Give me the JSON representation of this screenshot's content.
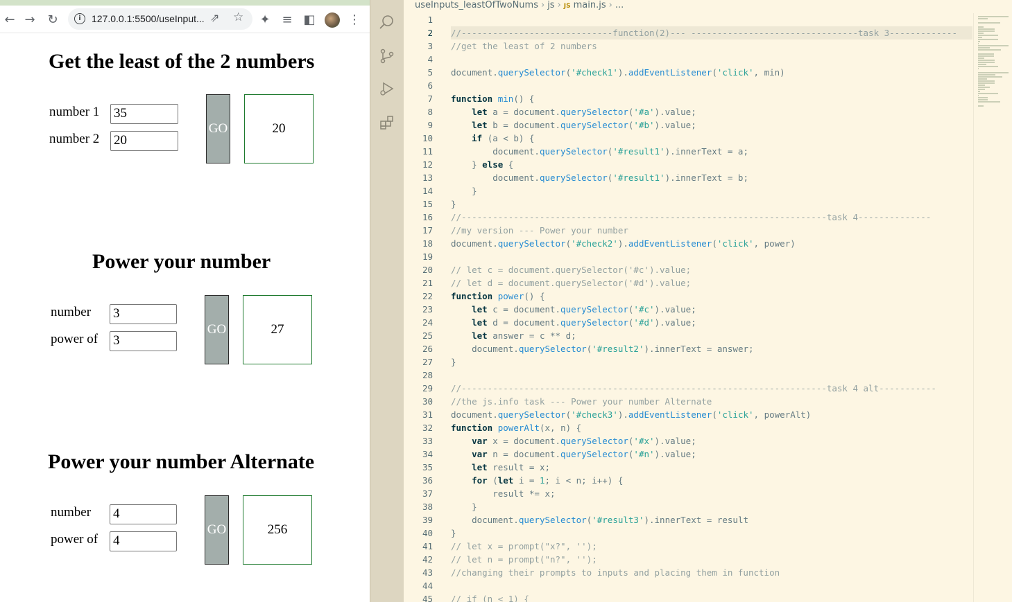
{
  "browser": {
    "url": "127.0.0.1:5500/useInput...",
    "sections": [
      {
        "title": "Get the least of the 2 numbers",
        "label1": "number 1",
        "label2": "number 2",
        "value1": "35",
        "value2": "20",
        "go_label": "GO",
        "result": "20"
      },
      {
        "title": "Power your number",
        "label1": "number",
        "label2": "power of",
        "value1": "3",
        "value2": "3",
        "go_label": "GO",
        "result": "27"
      },
      {
        "title": "Power your number Alternate",
        "label1": "number",
        "label2": "power of",
        "value1": "4",
        "value2": "4",
        "go_label": "GO",
        "result": "256"
      }
    ]
  },
  "editor": {
    "breadcrumb": {
      "folder": "useInputs_leastOfTwoNums",
      "subfolder": "js",
      "file_badge": "JS",
      "file": "main.js",
      "more": "..."
    },
    "active_line": 2,
    "lines": [
      [],
      [
        [
          "cm",
          "//-----------------------------function(2)--- --------------------------------task 3-------------"
        ]
      ],
      [
        [
          "cm",
          "//get the least of 2 numbers"
        ]
      ],
      [],
      [
        [
          "plain",
          "document."
        ],
        [
          "fn",
          "querySelector"
        ],
        [
          "plain",
          "("
        ],
        [
          "str",
          "'#check1'"
        ],
        [
          "plain",
          ")."
        ],
        [
          "fn",
          "addEventListener"
        ],
        [
          "plain",
          "("
        ],
        [
          "str",
          "'click'"
        ],
        [
          "plain",
          ", min)"
        ]
      ],
      [],
      [
        [
          "kw",
          "function"
        ],
        [
          "plain",
          " "
        ],
        [
          "fn",
          "min"
        ],
        [
          "plain",
          "() {"
        ]
      ],
      [
        [
          "plain",
          "    "
        ],
        [
          "kw",
          "let"
        ],
        [
          "plain",
          " a = document."
        ],
        [
          "fn",
          "querySelector"
        ],
        [
          "plain",
          "("
        ],
        [
          "str",
          "'#a'"
        ],
        [
          "plain",
          ").value;"
        ]
      ],
      [
        [
          "plain",
          "    "
        ],
        [
          "kw",
          "let"
        ],
        [
          "plain",
          " b = document."
        ],
        [
          "fn",
          "querySelector"
        ],
        [
          "plain",
          "("
        ],
        [
          "str",
          "'#b'"
        ],
        [
          "plain",
          ").value;"
        ]
      ],
      [
        [
          "plain",
          "    "
        ],
        [
          "kw",
          "if"
        ],
        [
          "plain",
          " (a < b) {"
        ]
      ],
      [
        [
          "plain",
          "        document."
        ],
        [
          "fn",
          "querySelector"
        ],
        [
          "plain",
          "("
        ],
        [
          "str",
          "'#result1'"
        ],
        [
          "plain",
          ").innerText = a;"
        ]
      ],
      [
        [
          "plain",
          "    } "
        ],
        [
          "kw",
          "else"
        ],
        [
          "plain",
          " {"
        ]
      ],
      [
        [
          "plain",
          "        document."
        ],
        [
          "fn",
          "querySelector"
        ],
        [
          "plain",
          "("
        ],
        [
          "str",
          "'#result1'"
        ],
        [
          "plain",
          ").innerText = b;"
        ]
      ],
      [
        [
          "plain",
          "    }"
        ]
      ],
      [
        [
          "plain",
          "}"
        ]
      ],
      [
        [
          "cm",
          "//----------------------------------------------------------------------task 4--------------"
        ]
      ],
      [
        [
          "cm",
          "//my version --- Power your number"
        ]
      ],
      [
        [
          "plain",
          "document."
        ],
        [
          "fn",
          "querySelector"
        ],
        [
          "plain",
          "("
        ],
        [
          "str",
          "'#check2'"
        ],
        [
          "plain",
          ")."
        ],
        [
          "fn",
          "addEventListener"
        ],
        [
          "plain",
          "("
        ],
        [
          "str",
          "'click'"
        ],
        [
          "plain",
          ", power)"
        ]
      ],
      [],
      [
        [
          "cm",
          "// let c = document.querySelector('#c').value;"
        ]
      ],
      [
        [
          "cm",
          "// let d = document.querySelector('#d').value;"
        ]
      ],
      [
        [
          "kw",
          "function"
        ],
        [
          "plain",
          " "
        ],
        [
          "fn",
          "power"
        ],
        [
          "plain",
          "() {"
        ]
      ],
      [
        [
          "plain",
          "    "
        ],
        [
          "kw",
          "let"
        ],
        [
          "plain",
          " c = document."
        ],
        [
          "fn",
          "querySelector"
        ],
        [
          "plain",
          "("
        ],
        [
          "str",
          "'#c'"
        ],
        [
          "plain",
          ").value;"
        ]
      ],
      [
        [
          "plain",
          "    "
        ],
        [
          "kw",
          "let"
        ],
        [
          "plain",
          " d = document."
        ],
        [
          "fn",
          "querySelector"
        ],
        [
          "plain",
          "("
        ],
        [
          "str",
          "'#d'"
        ],
        [
          "plain",
          ").value;"
        ]
      ],
      [
        [
          "plain",
          "    "
        ],
        [
          "kw",
          "let"
        ],
        [
          "plain",
          " answer = c ** d;"
        ]
      ],
      [
        [
          "plain",
          "    document."
        ],
        [
          "fn",
          "querySelector"
        ],
        [
          "plain",
          "("
        ],
        [
          "str",
          "'#result2'"
        ],
        [
          "plain",
          ").innerText = answer;"
        ]
      ],
      [
        [
          "plain",
          "}"
        ]
      ],
      [],
      [
        [
          "cm",
          "//----------------------------------------------------------------------task 4 alt-----------"
        ]
      ],
      [
        [
          "cm",
          "//the js.info task --- Power your number Alternate"
        ]
      ],
      [
        [
          "plain",
          "document."
        ],
        [
          "fn",
          "querySelector"
        ],
        [
          "plain",
          "("
        ],
        [
          "str",
          "'#check3'"
        ],
        [
          "plain",
          ")."
        ],
        [
          "fn",
          "addEventListener"
        ],
        [
          "plain",
          "("
        ],
        [
          "str",
          "'click'"
        ],
        [
          "plain",
          ", powerAlt)"
        ]
      ],
      [
        [
          "kw",
          "function"
        ],
        [
          "plain",
          " "
        ],
        [
          "fn",
          "powerAlt"
        ],
        [
          "plain",
          "(x, n) {"
        ]
      ],
      [
        [
          "plain",
          "    "
        ],
        [
          "kw",
          "var"
        ],
        [
          "plain",
          " x = document."
        ],
        [
          "fn",
          "querySelector"
        ],
        [
          "plain",
          "("
        ],
        [
          "str",
          "'#x'"
        ],
        [
          "plain",
          ").value;"
        ]
      ],
      [
        [
          "plain",
          "    "
        ],
        [
          "kw",
          "var"
        ],
        [
          "plain",
          " n = document."
        ],
        [
          "fn",
          "querySelector"
        ],
        [
          "plain",
          "("
        ],
        [
          "str",
          "'#n'"
        ],
        [
          "plain",
          ").value;"
        ]
      ],
      [
        [
          "plain",
          "    "
        ],
        [
          "kw",
          "let"
        ],
        [
          "plain",
          " result = x;"
        ]
      ],
      [
        [
          "plain",
          "    "
        ],
        [
          "kw",
          "for"
        ],
        [
          "plain",
          " ("
        ],
        [
          "kw",
          "let"
        ],
        [
          "plain",
          " i = "
        ],
        [
          "str",
          "1"
        ],
        [
          "plain",
          "; i < n; i++) {"
        ]
      ],
      [
        [
          "plain",
          "        result *= x;"
        ]
      ],
      [
        [
          "plain",
          "    }"
        ]
      ],
      [
        [
          "plain",
          "    document."
        ],
        [
          "fn",
          "querySelector"
        ],
        [
          "plain",
          "("
        ],
        [
          "str",
          "'#result3'"
        ],
        [
          "plain",
          ").innerText = result"
        ]
      ],
      [
        [
          "plain",
          "}"
        ]
      ],
      [
        [
          "cm",
          "// let x = prompt(\"x?\", '');"
        ]
      ],
      [
        [
          "cm",
          "// let n = prompt(\"n?\", '');"
        ]
      ],
      [
        [
          "cm",
          "//changing their prompts to inputs and placing them in function"
        ]
      ],
      [],
      [
        [
          "cm",
          "// if (n < 1) {"
        ]
      ]
    ]
  }
}
